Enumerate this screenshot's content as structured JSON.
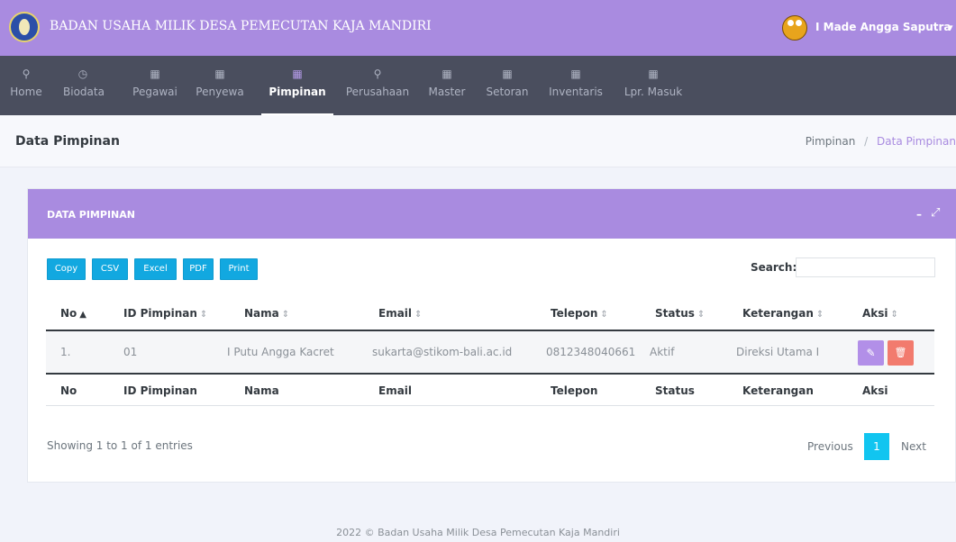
{
  "topbar": {
    "app_title": "BADAN USAHA MILIK DESA PEMECUTAN KAJA MANDIRI",
    "user_name": "I Made Angga Saputra"
  },
  "nav": {
    "items": [
      {
        "label": "Home",
        "icon": "wrench-icon"
      },
      {
        "label": "Biodata",
        "icon": "clock-icon"
      },
      {
        "label": "Pegawai",
        "icon": "calendar-icon"
      },
      {
        "label": "Penyewa",
        "icon": "calendar-icon"
      },
      {
        "label": "Pimpinan",
        "icon": "calendar-icon",
        "active": true
      },
      {
        "label": "Perusahaan",
        "icon": "wrench-icon"
      },
      {
        "label": "Master",
        "icon": "calendar-icon"
      },
      {
        "label": "Setoran",
        "icon": "calendar-icon"
      },
      {
        "label": "Inventaris",
        "icon": "calendar-icon"
      },
      {
        "label": "Lpr. Masuk",
        "icon": "calendar-icon"
      }
    ]
  },
  "page": {
    "title": "Data Pimpinan",
    "breadcrumb": {
      "parent": "Pimpinan",
      "separator": "/",
      "current": "Data Pimpinan"
    }
  },
  "card": {
    "title": "DATA PIMPINAN",
    "export_buttons": [
      "Copy",
      "CSV",
      "Excel",
      "PDF",
      "Print"
    ],
    "search_label": "Search:",
    "search_value": ""
  },
  "table": {
    "columns": [
      "No",
      "ID Pimpinan",
      "Nama",
      "Email",
      "Telepon",
      "Status",
      "Keterangan",
      "Aksi"
    ],
    "rows": [
      [
        "1.",
        "01",
        "I Putu Angga Kacret",
        "sukarta@stikom-bali.ac.id",
        "0812348040661",
        "Aktif",
        "Direksi Utama I"
      ]
    ],
    "info": "Showing 1 to 1 of 1 entries",
    "pagination": {
      "previous": "Previous",
      "current": "1",
      "next": "Next"
    }
  },
  "footer": {
    "text": "2022 © Badan Usaha Milik Desa Pemecutan Kaja Mandiri"
  },
  "colors": {
    "accent": "#a98be0",
    "nav_bg": "#4a4e5e",
    "button_blue": "#12a8e0",
    "edit": "#b28fe8",
    "delete": "#f27b6e",
    "page_active": "#11c5f0"
  }
}
